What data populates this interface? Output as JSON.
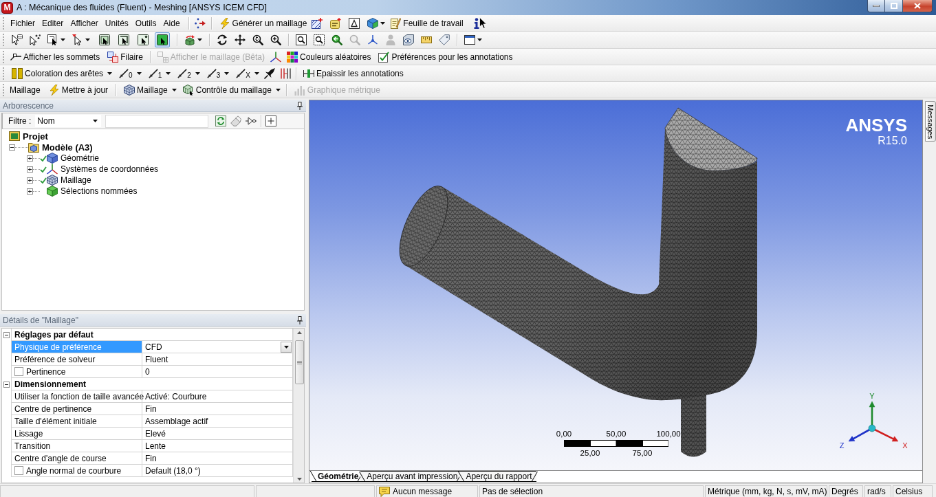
{
  "window": {
    "app_badge": "M",
    "title": "A : Mécanique des fluides (Fluent) - Meshing [ANSYS ICEM CFD]"
  },
  "menu": [
    "Fichier",
    "Editer",
    "Afficher",
    "Unités",
    "Outils",
    "Aide"
  ],
  "toolbar_main": {
    "generate_mesh": "Générer un maillage",
    "worksheet": "Feuille de travail"
  },
  "toolbar_select": {
    "modes": [
      {
        "selected": false
      },
      {
        "selected": false
      },
      {
        "selected": false
      },
      {
        "selected": true
      }
    ]
  },
  "toolbar_display": {
    "show_vertices": "Afficher les sommets",
    "wireframe": "Filaire",
    "show_mesh": {
      "label": "Afficher le maillage (Bêta)",
      "disabled": true
    },
    "random_colors": "Couleurs aléatoires",
    "annotation_preferences": "Préférences pour les annotations"
  },
  "toolbar_edges": {
    "edge_coloring": "Coloration des arêtes",
    "edge_buttons": [
      "0",
      "1",
      "2",
      "3",
      "X"
    ],
    "thicken_annotations": "Epaissir les annotations"
  },
  "toolbar_mesh": {
    "title": "Maillage",
    "update": "Mettre à jour",
    "mesh_menu": "Maillage",
    "mesh_control": "Contrôle du maillage",
    "metric_graph": {
      "label": "Graphique métrique",
      "disabled": true
    }
  },
  "tree_panel": {
    "title": "Arborescence",
    "filter": {
      "label": "Filtre :",
      "field": "Nom"
    },
    "items": [
      {
        "kind": "project",
        "label": "Projet",
        "children": [
          {
            "kind": "model",
            "label": "Modèle (A3)",
            "expanded": true,
            "children": [
              {
                "kind": "geometry",
                "label": "Géométrie",
                "expanded": false,
                "status_ok": true
              },
              {
                "kind": "coordinates",
                "label": "Systèmes de coordonnées",
                "expanded": false,
                "status_ok": true
              },
              {
                "kind": "mesh",
                "label": "Maillage",
                "expanded": false,
                "status_ok": true
              },
              {
                "kind": "named_selections",
                "label": "Sélections nommées",
                "expanded": false,
                "status_ok": false
              }
            ]
          }
        ]
      }
    ]
  },
  "details_panel": {
    "title": "Détails de \"Maillage\"",
    "groups": [
      {
        "label": "Réglages par défaut",
        "expanded": true,
        "rows": [
          {
            "kind": "dropdown",
            "name": "Physique de préférence",
            "value": "CFD",
            "selected": true
          },
          {
            "kind": "text",
            "name": "Préférence de solveur",
            "value": "Fluent",
            "selected": false
          },
          {
            "kind": "checkbox",
            "name": "Pertinence",
            "value": "0",
            "selected": false,
            "checked": false
          }
        ]
      },
      {
        "label": "Dimensionnement",
        "expanded": true,
        "rows": [
          {
            "kind": "text",
            "name": "Utiliser la fonction de taille avancée",
            "value": "Activé: Courbure",
            "selected": false
          },
          {
            "kind": "text",
            "name": "Centre de pertinence",
            "value": "Fin",
            "selected": false
          },
          {
            "kind": "text",
            "name": "Taille d'élément initiale",
            "value": "Assemblage actif",
            "selected": false
          },
          {
            "kind": "text",
            "name": "Lissage",
            "value": "Elevé",
            "selected": false
          },
          {
            "kind": "text",
            "name": "Transition",
            "value": "Lente",
            "selected": false
          },
          {
            "kind": "text",
            "name": "Centre d'angle de course",
            "value": "Fin",
            "selected": false
          },
          {
            "kind": "checkbox",
            "name": "Angle normal de courbure",
            "value": "Default (18,0 °)",
            "selected": false,
            "checked": false
          }
        ]
      }
    ]
  },
  "viewport": {
    "logo": {
      "brand": "ANSYS",
      "version": "R15.0"
    },
    "scale_bar": {
      "top_labels": [
        "0,00",
        "50,00",
        "100,00"
      ],
      "bottom_labels": [
        "25,00",
        "75,00"
      ]
    },
    "axes": [
      {
        "label": "X",
        "color": "#d02020"
      },
      {
        "label": "Y",
        "color": "#1e8a2e"
      },
      {
        "label": "Z",
        "color": "#1f33c8"
      }
    ]
  },
  "view_tabs": [
    {
      "label": "Géométrie",
      "selected": true
    },
    {
      "label": "Aperçu avant impression",
      "selected": false
    },
    {
      "label": "Aperçu du rapport",
      "selected": false
    }
  ],
  "side_tab": "Messages",
  "status_bar": {
    "messages": "Aucun message",
    "selection": "Pas de sélection",
    "units": "Métrique (mm, kg, N, s, mV, mA)",
    "angle": "Degrés",
    "angular_velocity": "rad/s",
    "temperature": "Celsius"
  }
}
